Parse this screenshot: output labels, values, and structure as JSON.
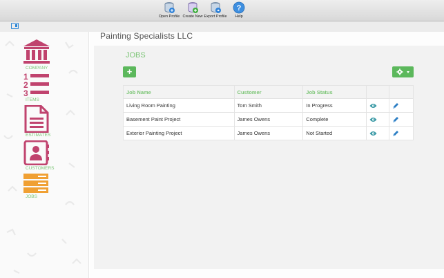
{
  "toolbar": {
    "buttons": [
      {
        "label": "Open Profile",
        "icon": "open-profile-icon"
      },
      {
        "label": "Create New",
        "icon": "create-new-icon"
      },
      {
        "label": "Export Profile",
        "icon": "export-profile-icon"
      },
      {
        "label": "Help",
        "icon": "help-icon"
      }
    ]
  },
  "sidebar": {
    "items": [
      {
        "label": "COMPANY",
        "icon": "bank-icon",
        "color": "#c0436e"
      },
      {
        "label": "ITEMS",
        "icon": "numbered-list-icon",
        "color": "#c0436e"
      },
      {
        "label": "ESTIMATES",
        "icon": "document-icon",
        "color": "#c0436e"
      },
      {
        "label": "CUSTOMERS",
        "icon": "contacts-book-icon",
        "color": "#c0436e"
      },
      {
        "label": "JOBS",
        "icon": "stacked-bars-icon",
        "color": "#f0a033"
      }
    ]
  },
  "main": {
    "company_name": "Painting Specialists LLC",
    "section_title": "JOBS",
    "add_button": "+",
    "accent_color": "#7cc576",
    "button_color": "#5cb85c",
    "table": {
      "headers": [
        "Job Name",
        "Customer",
        "Job Status",
        "",
        ""
      ],
      "rows": [
        {
          "job_name": "Living Room Painting",
          "customer": "Tom Smith",
          "status": "In Progress"
        },
        {
          "job_name": "Basement Paint Project",
          "customer": "James Owens",
          "status": "Complete"
        },
        {
          "job_name": "Exterior Painting Project",
          "customer": "James Owens",
          "status": "Not Started"
        }
      ]
    }
  }
}
